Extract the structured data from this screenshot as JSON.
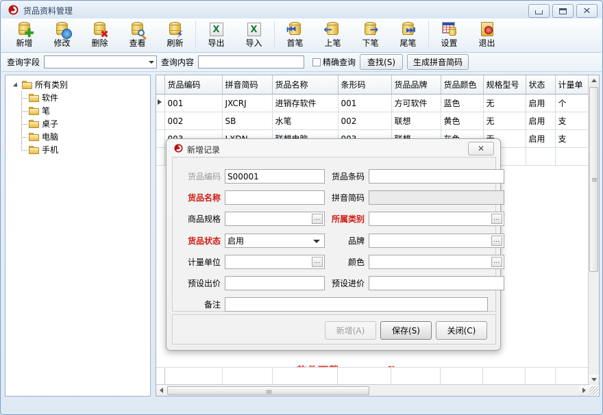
{
  "window": {
    "title": "货品资料管理",
    "icon": "app-logo-icon",
    "controls": {
      "minimize": "最小化",
      "maximize": "还原",
      "close": "关闭"
    }
  },
  "toolbar": {
    "items": [
      {
        "label": "新增",
        "icon": "db-add-icon"
      },
      {
        "label": "修改",
        "icon": "db-edit-icon"
      },
      {
        "label": "删除",
        "icon": "db-delete-icon"
      },
      {
        "label": "查看",
        "icon": "db-view-icon"
      },
      {
        "label": "刷新",
        "icon": "db-refresh-icon"
      },
      {
        "label": "导出",
        "icon": "excel-export-icon"
      },
      {
        "label": "导入",
        "icon": "excel-import-icon"
      },
      {
        "label": "首笔",
        "icon": "first-record-icon"
      },
      {
        "label": "上笔",
        "icon": "prev-record-icon"
      },
      {
        "label": "下笔",
        "icon": "next-record-icon"
      },
      {
        "label": "尾笔",
        "icon": "last-record-icon"
      },
      {
        "label": "设置",
        "icon": "settings-grid-icon"
      },
      {
        "label": "退出",
        "icon": "exit-icon"
      }
    ]
  },
  "querybar": {
    "field_label": "查询字段",
    "field_value": "",
    "content_label": "查询内容",
    "content_value": "",
    "exact_label": "精确查询",
    "exact_checked": false,
    "search_button": "查找(S)",
    "pinyin_button": "生成拼音简码"
  },
  "tree": {
    "root": "所有类别",
    "children": [
      "软件",
      "笔",
      "桌子",
      "电脑",
      "手机"
    ]
  },
  "grid": {
    "columns": [
      "货品编码",
      "拼音简码",
      "货品名称",
      "条形码",
      "货品品牌",
      "货品颜色",
      "规格型号",
      "状态",
      "计量单"
    ],
    "rows": [
      {
        "selected": true,
        "cells": [
          "001",
          "JXCRJ",
          "进销存软件",
          "001",
          "方可软件",
          "蓝色",
          "无",
          "启用",
          "个"
        ]
      },
      {
        "selected": false,
        "cells": [
          "002",
          "SB",
          "水笔",
          "002",
          "联想",
          "黄色",
          "无",
          "启用",
          "支"
        ]
      },
      {
        "selected": false,
        "cells": [
          "003",
          "LXDN",
          "联想电脑",
          "003",
          "联想",
          "灰色",
          "无",
          "启用",
          "支"
        ]
      }
    ]
  },
  "watermark": "软件下载： www.fkerp.com",
  "dialog": {
    "title": "新增记录",
    "icon": "app-logo-icon",
    "close_label": "✕",
    "fields": {
      "code": {
        "label": "货品编码",
        "value": "S00001",
        "required": false,
        "disabled": true
      },
      "barcode": {
        "label": "货品条码",
        "value": "",
        "required": false,
        "disabled": false
      },
      "name": {
        "label": "货品名称",
        "value": "",
        "required": true,
        "disabled": false
      },
      "pinyin": {
        "label": "拼音简码",
        "value": "",
        "required": false,
        "disabled": true
      },
      "spec": {
        "label": "商品规格",
        "value": "",
        "required": false,
        "picker": "…"
      },
      "category": {
        "label": "所属类别",
        "value": "",
        "required": true,
        "picker": "…"
      },
      "status": {
        "label": "货品状态",
        "value": "启用",
        "required": true,
        "dropdown": true
      },
      "brand": {
        "label": "品牌",
        "value": "",
        "required": false,
        "picker": "…"
      },
      "unit": {
        "label": "计量单位",
        "value": "",
        "required": false,
        "picker": "…"
      },
      "color": {
        "label": "颜色",
        "value": "",
        "required": false,
        "picker": "…"
      },
      "sale_price": {
        "label": "预设出价",
        "value": "",
        "required": false
      },
      "buy_price": {
        "label": "预设进价",
        "value": "",
        "required": false
      },
      "remark": {
        "label": "备注",
        "value": "",
        "required": false
      }
    },
    "buttons": {
      "add": {
        "label": "新增(A)",
        "disabled": true
      },
      "save": {
        "label": "保存(S)",
        "disabled": false
      },
      "close": {
        "label": "关闭(C)",
        "disabled": false
      }
    }
  },
  "colors": {
    "required": "#d11a12",
    "watermark": "#e23a28",
    "accent": "#7a9cc6"
  }
}
